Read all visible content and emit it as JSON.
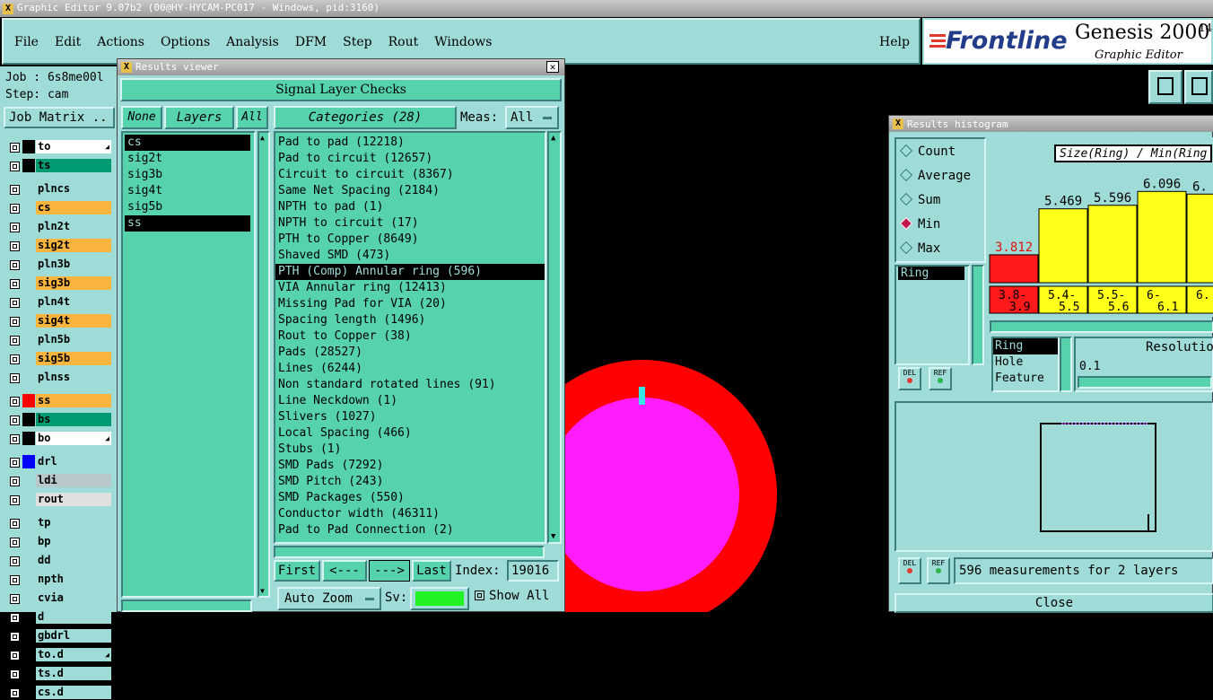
{
  "app": {
    "title": "Graphic Editor 9.07b2 (00@HY-HYCAM-PC017 - Windows, pid:3160)",
    "menu": [
      "File",
      "Edit",
      "Actions",
      "Options",
      "Analysis",
      "DFM",
      "Step",
      "Rout",
      "Windows"
    ],
    "help": "Help",
    "brand": "Frontline",
    "product": "Genesis 2000",
    "product_sup": "14",
    "product_sub": "Graphic Editor"
  },
  "job": {
    "job_label": "Job : 6s8me00l",
    "step_label": "Step: cam",
    "matrix_button": "Job Matrix .."
  },
  "layers": [
    {
      "name": "to",
      "color": "#ffffff",
      "flag": true,
      "swatch": "#000000"
    },
    {
      "name": "ts",
      "color": "#009b72",
      "flag": false,
      "swatch": "#000000"
    },
    {
      "name": "plncs",
      "color": "#9fdcd8",
      "flag": false,
      "swatch": ""
    },
    {
      "name": "cs",
      "color": "#f9b53d",
      "flag": false,
      "swatch": ""
    },
    {
      "name": "pln2t",
      "color": "#9fdcd8",
      "flag": false,
      "swatch": ""
    },
    {
      "name": "sig2t",
      "color": "#f9b53d",
      "flag": false,
      "swatch": ""
    },
    {
      "name": "pln3b",
      "color": "#9fdcd8",
      "flag": false,
      "swatch": ""
    },
    {
      "name": "sig3b",
      "color": "#f9b53d",
      "flag": false,
      "swatch": ""
    },
    {
      "name": "pln4t",
      "color": "#9fdcd8",
      "flag": false,
      "swatch": ""
    },
    {
      "name": "sig4t",
      "color": "#f9b53d",
      "flag": false,
      "swatch": ""
    },
    {
      "name": "pln5b",
      "color": "#9fdcd8",
      "flag": false,
      "swatch": ""
    },
    {
      "name": "sig5b",
      "color": "#f9b53d",
      "flag": false,
      "swatch": ""
    },
    {
      "name": "plnss",
      "color": "#9fdcd8",
      "flag": false,
      "swatch": ""
    },
    {
      "name": "ss",
      "color": "#f9b53d",
      "flag": false,
      "swatch": "#ff0000"
    },
    {
      "name": "bs",
      "color": "#009b72",
      "flag": false,
      "swatch": "#000000"
    },
    {
      "name": "bo",
      "color": "#ffffff",
      "flag": true,
      "swatch": "#000000"
    },
    {
      "name": "drl",
      "color": "#9fdcd8",
      "flag": false,
      "swatch": "#0000ff"
    },
    {
      "name": "ldi",
      "color": "#b8c8cc",
      "flag": false,
      "swatch": ""
    },
    {
      "name": "rout",
      "color": "#e0e0e0",
      "flag": false,
      "swatch": ""
    },
    {
      "name": "tp",
      "color": "#9fdcd8",
      "flag": false,
      "swatch": ""
    },
    {
      "name": "bp",
      "color": "#9fdcd8",
      "flag": false,
      "swatch": ""
    },
    {
      "name": "dd",
      "color": "#9fdcd8",
      "flag": false,
      "swatch": ""
    },
    {
      "name": "npth",
      "color": "#9fdcd8",
      "flag": false,
      "swatch": ""
    },
    {
      "name": "cvia",
      "color": "#9fdcd8",
      "flag": false,
      "swatch": ""
    },
    {
      "name": "d",
      "color": "#9fdcd8",
      "flag": false,
      "swatch": ""
    },
    {
      "name": "gbdrl",
      "color": "#9fdcd8",
      "flag": false,
      "swatch": ""
    },
    {
      "name": "to.d",
      "color": "#9fdcd8",
      "flag": true,
      "swatch": ""
    },
    {
      "name": "ts.d",
      "color": "#9fdcd8",
      "flag": false,
      "swatch": ""
    },
    {
      "name": "cs.d",
      "color": "#9fdcd8",
      "flag": false,
      "swatch": ""
    }
  ],
  "results_viewer": {
    "title": "Results viewer",
    "header": "Signal Layer Checks",
    "none_btn": "None",
    "layers_btn": "Layers",
    "all_btn": "All",
    "layer_list": [
      "cs",
      "sig2t",
      "sig3b",
      "sig4t",
      "sig5b",
      "ss"
    ],
    "selected_layers": [
      "cs",
      "ss"
    ],
    "categories_btn": "Categories (28)",
    "meas_label": "Meas:",
    "meas_value": "All",
    "categories": [
      "Pad to pad (12218)",
      "Pad to circuit (12657)",
      "Circuit to circuit (8367)",
      "Same Net Spacing (2184)",
      "NPTH to pad (1)",
      "NPTH to circuit (17)",
      "PTH to Copper (8649)",
      "Shaved SMD (473)",
      "PTH (Comp) Annular ring (596)",
      "VIA Annular ring (12413)",
      "Missing Pad for VIA (20)",
      "Spacing length (1496)",
      "Rout to Copper (38)",
      "Pads (28527)",
      "Lines (6244)",
      "Non standard rotated lines (91)",
      "Line Neckdown (1)",
      "Slivers (1027)",
      "Local Spacing (466)",
      "Stubs (1)",
      "SMD Pads (7292)",
      "SMD Pitch (243)",
      "SMD Packages (550)",
      "Conductor width (46311)",
      "Pad to Pad Connection (2)"
    ],
    "selected_category": "PTH (Comp) Annular ring (596)",
    "first_btn": "First",
    "prev_btn": "<---",
    "next_btn": "--->",
    "last_btn": "Last",
    "index_label": "Index:",
    "index_value": "19016",
    "auto_zoom": "Auto Zoom",
    "sv_label": "Sv:",
    "show_all": "Show All"
  },
  "histogram": {
    "title": "Results histogram",
    "header": "Size(Ring) / Min(Ring",
    "stat_options": [
      "Count",
      "Average",
      "Sum",
      "Min",
      "Max"
    ],
    "selected_stat": "Min",
    "list_value": "Ring",
    "del_btn": "DEL",
    "ref_btn": "REF",
    "fields": [
      "Ring",
      "Hole",
      "Feature"
    ],
    "resolution_label": "Resolutio",
    "resolution_value": "0.1",
    "status": "596 measurements for 2 layers",
    "close_btn": "Close",
    "accent_red": "#ff1a1a",
    "accent_yellow": "#ffff1a"
  },
  "chart_data": {
    "type": "bar",
    "categories": [
      "3.8-3.9",
      "5.4-5.5",
      "5.5-5.6",
      "6-6.1",
      "6."
    ],
    "values": [
      3.812,
      5.469,
      5.596,
      6.096,
      6.0
    ],
    "value_labels": [
      "3.812",
      "5.469",
      "5.596",
      "6.096",
      "6."
    ],
    "colors": [
      "#ff1a1a",
      "#ffff1a",
      "#ffff1a",
      "#ffff1a",
      "#ffff1a"
    ],
    "title": "Size(Ring) / Min(Ring"
  }
}
